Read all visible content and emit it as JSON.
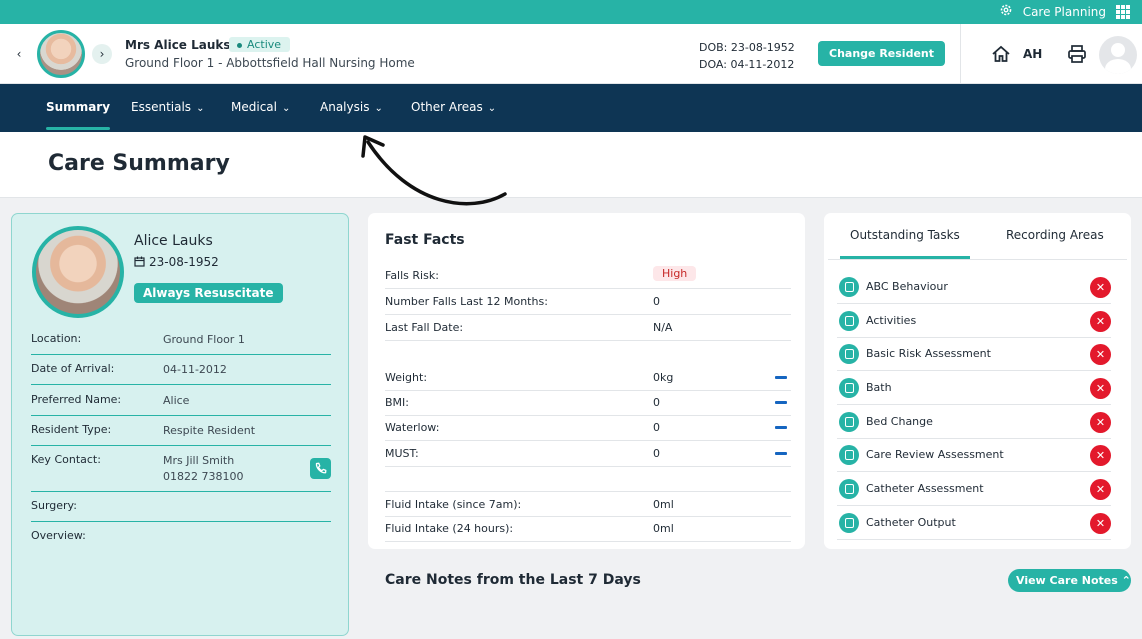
{
  "topbar": {
    "app_title": "Care Planning"
  },
  "resident_header": {
    "name": "Mrs Alice Lauks",
    "status": "Active",
    "location": "Ground Floor 1 - Abbottsfield Hall Nursing Home",
    "dob": "DOB: 23-08-1952",
    "doa": "DOA: 04-11-2012",
    "change_resident": "Change Resident",
    "user_initials": "AH"
  },
  "nav": {
    "items": [
      {
        "label": "Summary",
        "has_dropdown": false,
        "active": true
      },
      {
        "label": "Essentials",
        "has_dropdown": true
      },
      {
        "label": "Medical",
        "has_dropdown": true
      },
      {
        "label": "Analysis",
        "has_dropdown": true
      },
      {
        "label": "Other Areas",
        "has_dropdown": true
      }
    ]
  },
  "page": {
    "title": "Care Summary"
  },
  "profile": {
    "name": "Alice Lauks",
    "dob": "23-08-1952",
    "resus_status": "Always Resuscitate",
    "rows": [
      {
        "label": "Location:",
        "value": "Ground Floor 1"
      },
      {
        "label": "Date of Arrival:",
        "value": "04-11-2012"
      },
      {
        "label": "Preferred Name:",
        "value": "Alice"
      },
      {
        "label": "Resident Type:",
        "value": "Respite Resident"
      },
      {
        "label": "Key Contact:",
        "value": "Mrs Jill Smith",
        "value2": "01822 738100"
      },
      {
        "label": "Surgery:",
        "value": ""
      },
      {
        "label": "Overview:",
        "value": ""
      }
    ]
  },
  "fast_facts": {
    "title": "Fast Facts",
    "rows": [
      {
        "label": "Falls Risk:",
        "value": "High"
      },
      {
        "label": "Number Falls Last 12 Months:",
        "value": "0"
      },
      {
        "label": "Last Fall Date:",
        "value": "N/A"
      },
      {
        "label": "Weight:",
        "value": "0kg"
      },
      {
        "label": "BMI:",
        "value": "0"
      },
      {
        "label": "Waterlow:",
        "value": "0"
      },
      {
        "label": "MUST:",
        "value": "0"
      },
      {
        "label": "Fluid Intake (since 7am):",
        "value": "0ml"
      },
      {
        "label": "Fluid Intake (24 hours):",
        "value": "0ml"
      }
    ]
  },
  "tasks": {
    "tabs": [
      "Outstanding Tasks",
      "Recording Areas"
    ],
    "items": [
      "ABC Behaviour",
      "Activities",
      "Basic Risk Assessment",
      "Bath",
      "Bed Change",
      "Care Review Assessment",
      "Catheter Assessment",
      "Catheter Output"
    ]
  },
  "care_notes": {
    "title": "Care Notes from the Last 7 Days",
    "view_button": "View Care Notes"
  },
  "colors": {
    "teal": "#27b3a6",
    "navy": "#0e3554",
    "danger": "#e3192c"
  }
}
